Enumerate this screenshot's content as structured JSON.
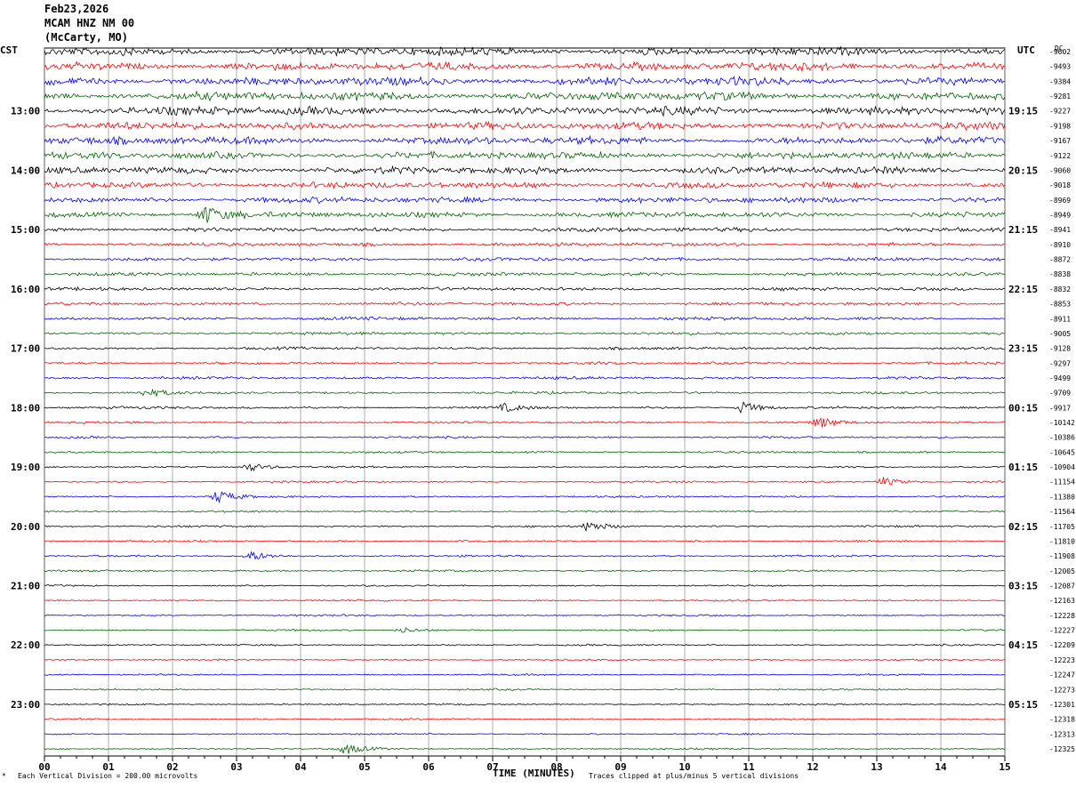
{
  "header": {
    "date": "Feb23,2026",
    "station": "MCAM HNZ NM 00",
    "location": "(McCarty, MO)"
  },
  "left_axis_label": "CST",
  "right_axis_label": "UTC",
  "dc_label": "DC",
  "footer": {
    "scale_note": "Each Vertical Division =  200.00 microvolts",
    "xlabel": "TIME (MINUTES)",
    "clip_note": "Traces clipped at plus/minus 5 vertical divisions"
  },
  "colors": {
    "trace_cycle": [
      "#000000",
      "#ff0000",
      "#0000ff",
      "#006400"
    ],
    "grid": "#888888"
  },
  "chart_data": {
    "type": "line",
    "title": "",
    "xlabel": "TIME (MINUTES)",
    "x_ticks": [
      "00",
      "01",
      "02",
      "03",
      "04",
      "05",
      "06",
      "07",
      "08",
      "09",
      "10",
      "11",
      "12",
      "13",
      "14",
      "15"
    ],
    "xlim": [
      0,
      15
    ],
    "minutes_per_row": 15,
    "left_time_labels": [
      "13:00",
      "14:00",
      "15:00",
      "16:00",
      "17:00",
      "18:00",
      "19:00",
      "20:00",
      "21:00",
      "22:00",
      "23:00"
    ],
    "right_time_labels": [
      "19:15",
      "20:15",
      "21:15",
      "22:15",
      "23:15",
      "00:15",
      "01:15",
      "02:15",
      "03:15",
      "04:15",
      "05:15"
    ],
    "dc_offsets": [
      "-9602",
      "-9493",
      "-9384",
      "-9281",
      "-9227",
      "-9198",
      "-9167",
      "-9122",
      "-9060",
      "-9018",
      "-8969",
      "-8949",
      "-8941",
      "-8910",
      "-8872",
      "-8838",
      "-8832",
      "-8853",
      "-8911",
      "-9005",
      "-9128",
      "-9297",
      "-9499",
      "-9709",
      "-9917",
      "-10142",
      "-10386",
      "-10645",
      "-10904",
      "-11154",
      "-11380",
      "-11564",
      "-11705",
      "-11810",
      "-11908",
      "-12005",
      "-12087",
      "-12163",
      "-12228",
      "-12227",
      "-12209",
      "-12223",
      "-12247",
      "-12273",
      "-12301",
      "-12318",
      "-12313",
      "-12325"
    ],
    "noise_level": [
      3.0,
      3.0,
      3.1,
      3.2,
      3.2,
      2.9,
      2.8,
      2.6,
      2.6,
      2.3,
      2.2,
      2.1,
      1.6,
      1.4,
      1.3,
      1.3,
      1.2,
      1.2,
      1.2,
      1.1,
      1.0,
      1.0,
      1.0,
      0.9,
      0.9,
      0.8,
      0.8,
      0.8,
      0.7,
      0.7,
      0.7,
      0.7,
      0.7,
      0.7,
      0.7,
      0.7,
      0.6,
      0.6,
      0.6,
      0.6,
      0.6,
      0.6,
      0.6,
      0.6,
      0.6,
      0.6,
      0.6,
      0.6
    ],
    "events": [
      {
        "row": 11,
        "minute": 2.5,
        "amp": 10
      },
      {
        "row": 23,
        "minute": 1.6,
        "amp": 4
      },
      {
        "row": 24,
        "minute": 7.2,
        "amp": 4
      },
      {
        "row": 24,
        "minute": 10.9,
        "amp": 7
      },
      {
        "row": 25,
        "minute": 12.1,
        "amp": 6
      },
      {
        "row": 28,
        "minute": 3.2,
        "amp": 5
      },
      {
        "row": 29,
        "minute": 13.1,
        "amp": 5
      },
      {
        "row": 30,
        "minute": 2.7,
        "amp": 7
      },
      {
        "row": 32,
        "minute": 8.5,
        "amp": 6
      },
      {
        "row": 34,
        "minute": 3.2,
        "amp": 6
      },
      {
        "row": 39,
        "minute": 5.6,
        "amp": 3
      },
      {
        "row": 47,
        "minute": 4.7,
        "amp": 6
      }
    ]
  }
}
